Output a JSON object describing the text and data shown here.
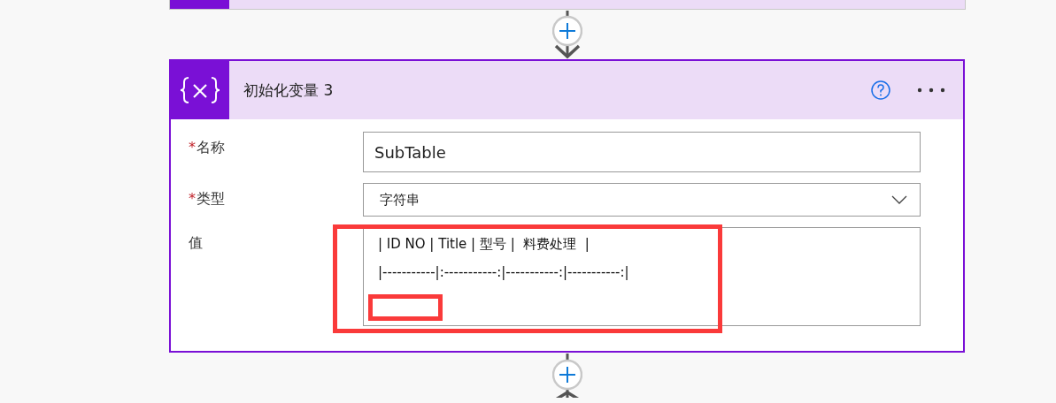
{
  "card": {
    "title": "初始化变量 3",
    "fields": [
      {
        "kind": "text",
        "label": "名称",
        "required_mark": "*",
        "value": "SubTable"
      },
      {
        "kind": "dropdown",
        "label": "类型",
        "required_mark": "*",
        "value": "字符串"
      },
      {
        "kind": "multiline",
        "label": "值",
        "lines": [
          "| ID NO | Title | 型号 |  料费处理  |",
          "|-----------|:-----------:|-----------:|-----------:|"
        ]
      }
    ]
  }
}
